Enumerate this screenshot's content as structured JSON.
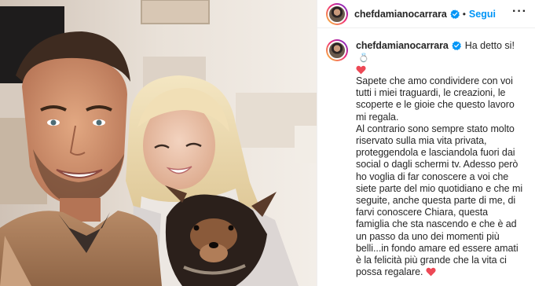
{
  "post": {
    "username": "chefdamianocarrara",
    "separator": "•",
    "follow_label": "Segui",
    "more_icon": "···",
    "verified_color": "#0095f6",
    "follow_color": "#0095f6"
  },
  "caption": {
    "username": "chefdamianocarrara",
    "lead": "Ha detto si!",
    "lead_emoji": "💍",
    "line_1": "Sapete che amo condividere con voi tutti i miei traguardi, le creazioni, le scoperte e le gioie che questo lavoro mi regala.",
    "line_2": "Al contrario sono sempre stato molto riservato sulla mia vita privata, proteggendola e lasciandola fuori dai social o dagli schermi tv. Adesso però ho voglia di far conoscere a voi che siete parte del mio quotidiano e che mi seguite, anche questa parte di me, di farvi conoscere Chiara, questa famiglia che sta nascendo e che è ad un passo da uno dei momenti più belli...in fondo amare ed essere amati è la felicità più grande che la vita ci possa regalare.",
    "heart_color": "#ed4956"
  },
  "icons": {
    "verified": "verified-badge-icon",
    "heart": "red-heart-icon",
    "ring": "ring-emoji-icon",
    "more": "more-options-icon"
  }
}
